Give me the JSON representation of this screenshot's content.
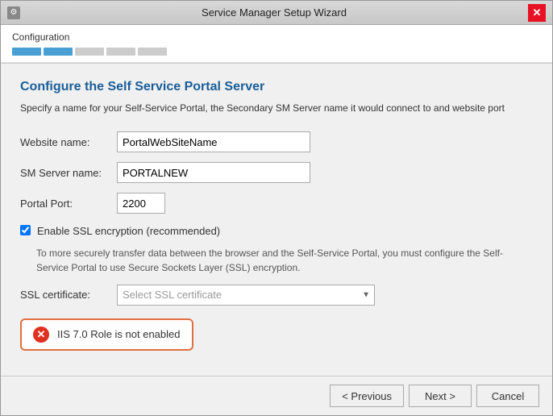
{
  "window": {
    "title": "Service Manager Setup Wizard",
    "close_label": "✕"
  },
  "breadcrumb": {
    "label": "Configuration",
    "steps": [
      {
        "active": true
      },
      {
        "active": true
      },
      {
        "active": false
      },
      {
        "active": false
      },
      {
        "active": false
      }
    ]
  },
  "section": {
    "title": "Configure the Self Service Portal Server",
    "description": "Specify a name for your Self-Service Portal, the Secondary SM Server name it would connect to and website port"
  },
  "form": {
    "website_name_label": "Website name:",
    "website_name_value": "PortalWebSiteName",
    "sm_server_label": "SM Server name:",
    "sm_server_value": "PORTALNEW",
    "portal_port_label": "Portal Port:",
    "portal_port_value": "2200",
    "ssl_checkbox_label": "Enable SSL encryption (recommended)",
    "ssl_subtext": "To more securely transfer data between the browser and the Self-Service Portal, you must configure the Self-Service Portal to use Secure Sockets Layer (SSL) encryption.",
    "ssl_cert_label": "SSL certificate:",
    "ssl_cert_placeholder": "Select SSL certificate"
  },
  "error": {
    "text": "IIS 7.0 Role is not enabled"
  },
  "footer": {
    "previous_label": "< Previous",
    "next_label": "Next >",
    "cancel_label": "Cancel"
  }
}
